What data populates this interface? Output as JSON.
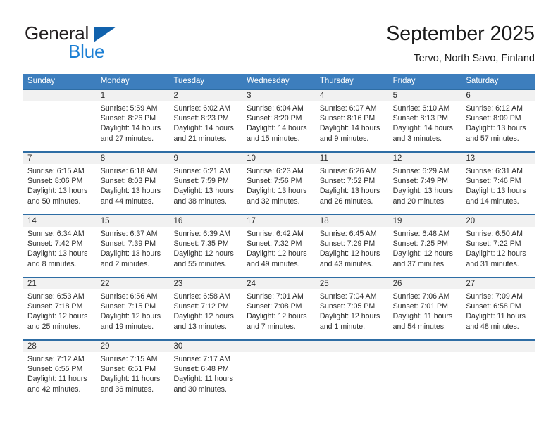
{
  "brand": {
    "word_one": "General",
    "word_two": "Blue",
    "triangle_icon": "brand-triangle-icon"
  },
  "header": {
    "title": "September 2025",
    "subtitle": "Tervo, North Savo, Finland"
  },
  "colors": {
    "header_blue": "#3d7ebd",
    "week_rule_blue": "#2e6da4",
    "numrow_gray": "#f1f1f1",
    "brand_blue": "#1b7fd4",
    "brand_triangle": "#1162ad",
    "text": "#2b2b2b"
  },
  "weekdays": [
    "Sunday",
    "Monday",
    "Tuesday",
    "Wednesday",
    "Thursday",
    "Friday",
    "Saturday"
  ],
  "weeks": [
    {
      "numbers": [
        "",
        "1",
        "2",
        "3",
        "4",
        "5",
        "6"
      ],
      "details": [
        "",
        "Sunrise: 5:59 AM\nSunset: 8:26 PM\nDaylight: 14 hours\nand 27 minutes.",
        "Sunrise: 6:02 AM\nSunset: 8:23 PM\nDaylight: 14 hours\nand 21 minutes.",
        "Sunrise: 6:04 AM\nSunset: 8:20 PM\nDaylight: 14 hours\nand 15 minutes.",
        "Sunrise: 6:07 AM\nSunset: 8:16 PM\nDaylight: 14 hours\nand 9 minutes.",
        "Sunrise: 6:10 AM\nSunset: 8:13 PM\nDaylight: 14 hours\nand 3 minutes.",
        "Sunrise: 6:12 AM\nSunset: 8:09 PM\nDaylight: 13 hours\nand 57 minutes."
      ]
    },
    {
      "numbers": [
        "7",
        "8",
        "9",
        "10",
        "11",
        "12",
        "13"
      ],
      "details": [
        "Sunrise: 6:15 AM\nSunset: 8:06 PM\nDaylight: 13 hours\nand 50 minutes.",
        "Sunrise: 6:18 AM\nSunset: 8:03 PM\nDaylight: 13 hours\nand 44 minutes.",
        "Sunrise: 6:21 AM\nSunset: 7:59 PM\nDaylight: 13 hours\nand 38 minutes.",
        "Sunrise: 6:23 AM\nSunset: 7:56 PM\nDaylight: 13 hours\nand 32 minutes.",
        "Sunrise: 6:26 AM\nSunset: 7:52 PM\nDaylight: 13 hours\nand 26 minutes.",
        "Sunrise: 6:29 AM\nSunset: 7:49 PM\nDaylight: 13 hours\nand 20 minutes.",
        "Sunrise: 6:31 AM\nSunset: 7:46 PM\nDaylight: 13 hours\nand 14 minutes."
      ]
    },
    {
      "numbers": [
        "14",
        "15",
        "16",
        "17",
        "18",
        "19",
        "20"
      ],
      "details": [
        "Sunrise: 6:34 AM\nSunset: 7:42 PM\nDaylight: 13 hours\nand 8 minutes.",
        "Sunrise: 6:37 AM\nSunset: 7:39 PM\nDaylight: 13 hours\nand 2 minutes.",
        "Sunrise: 6:39 AM\nSunset: 7:35 PM\nDaylight: 12 hours\nand 55 minutes.",
        "Sunrise: 6:42 AM\nSunset: 7:32 PM\nDaylight: 12 hours\nand 49 minutes.",
        "Sunrise: 6:45 AM\nSunset: 7:29 PM\nDaylight: 12 hours\nand 43 minutes.",
        "Sunrise: 6:48 AM\nSunset: 7:25 PM\nDaylight: 12 hours\nand 37 minutes.",
        "Sunrise: 6:50 AM\nSunset: 7:22 PM\nDaylight: 12 hours\nand 31 minutes."
      ]
    },
    {
      "numbers": [
        "21",
        "22",
        "23",
        "24",
        "25",
        "26",
        "27"
      ],
      "details": [
        "Sunrise: 6:53 AM\nSunset: 7:18 PM\nDaylight: 12 hours\nand 25 minutes.",
        "Sunrise: 6:56 AM\nSunset: 7:15 PM\nDaylight: 12 hours\nand 19 minutes.",
        "Sunrise: 6:58 AM\nSunset: 7:12 PM\nDaylight: 12 hours\nand 13 minutes.",
        "Sunrise: 7:01 AM\nSunset: 7:08 PM\nDaylight: 12 hours\nand 7 minutes.",
        "Sunrise: 7:04 AM\nSunset: 7:05 PM\nDaylight: 12 hours\nand 1 minute.",
        "Sunrise: 7:06 AM\nSunset: 7:01 PM\nDaylight: 11 hours\nand 54 minutes.",
        "Sunrise: 7:09 AM\nSunset: 6:58 PM\nDaylight: 11 hours\nand 48 minutes."
      ]
    },
    {
      "numbers": [
        "28",
        "29",
        "30",
        "",
        "",
        "",
        ""
      ],
      "details": [
        "Sunrise: 7:12 AM\nSunset: 6:55 PM\nDaylight: 11 hours\nand 42 minutes.",
        "Sunrise: 7:15 AM\nSunset: 6:51 PM\nDaylight: 11 hours\nand 36 minutes.",
        "Sunrise: 7:17 AM\nSunset: 6:48 PM\nDaylight: 11 hours\nand 30 minutes.",
        "",
        "",
        "",
        ""
      ]
    }
  ]
}
